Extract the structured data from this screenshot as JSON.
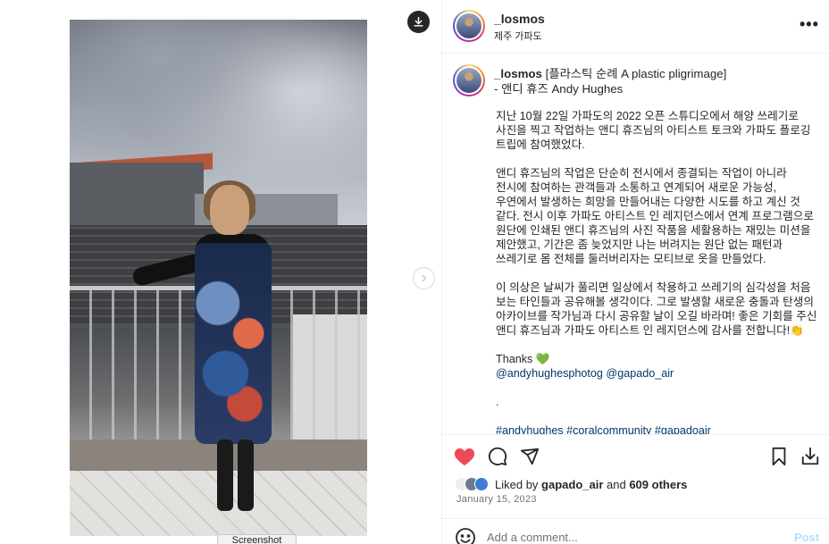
{
  "post": {
    "username": "_losmos",
    "location": "제주 가파도",
    "more_label": "•••",
    "screenshot_label": "Screenshot"
  },
  "caption": {
    "username": "_losmos",
    "title_rest": " [플라스틱 순례 A plastic pligrimage]",
    "title_line2": "- 앤디 휴즈 Andy Hughes",
    "paragraphs": [
      "지난 10월 22일 가파도의 2022 오픈 스튜디오에서 해양 쓰레기로 사진을 찍고 작업하는 앤디 휴즈님의 아티스트 토크와 가파도 플로깅 트립에 참여했었다.",
      "앤디 휴즈님의 작업은 단순히 전시에서 종결되는 작업이 아니라 전시에 참여하는 관객들과 소통하고 연계되어 새로운 가능성, 우연에서 발생하는 희망을 만들어내는 다양한 시도를 하고 계신 것 같다. 전시 이후 가파도 아티스트 인 레지던스에서 연계 프로그램으로 원단에 인쇄된 앤디 휴즈님의 사진 작품을 세활용하는 재밌는 미션을 제안했고, 기간은 좀 늦었지만 나는 버려지는 원단 없는 패턴과 쓰레기로 몸 전체를 둘러버리자는 모티브로 옷을 만들었다.",
      "이 의상은 날씨가 풀리면 일상에서 착용하고 쓰레기의 심각성을 처음 보는 타인들과 공유해볼 생각이다. 그로 발생할 새로운 충돌과 탄생의 아카이브를 작가님과 다시 공유할 날이 오길 바라며! 좋은 기회를 주신 앤디 휴즈님과 가파도 아티스트 인 레지던스에 감사를 전합니다!👏"
    ],
    "thanks": "Thanks 💚",
    "mentions": "@andyhughesphotog @gapado_air",
    "dot": ".",
    "hashtags": "#andyhughes #coralcommunity #gapadoair"
  },
  "engagement": {
    "liked_by_prefix": "Liked by ",
    "liked_by_user": "gapado_air",
    "and_text": " and ",
    "others_count": "609 others",
    "date": "January 15, 2023"
  },
  "comment": {
    "placeholder": "Add a comment...",
    "post_label": "Post"
  },
  "colors": {
    "heart": "#ed4956",
    "link": "#00376b",
    "post_disabled": "#b2dffc"
  },
  "icons": [
    "download-icon",
    "chevron-right-icon",
    "more-icon",
    "heart-icon",
    "comment-icon",
    "share-icon",
    "bookmark-icon",
    "save-download-icon",
    "emoji-icon"
  ]
}
